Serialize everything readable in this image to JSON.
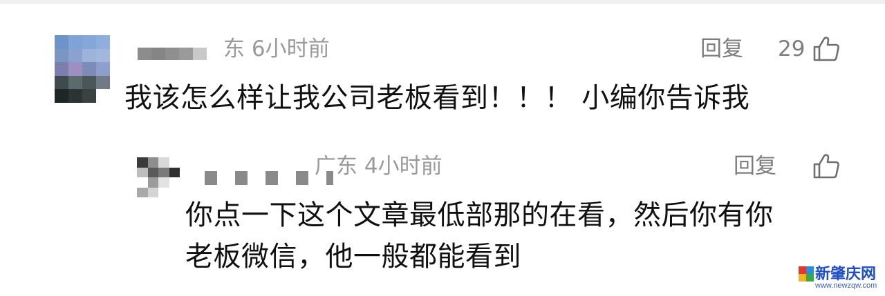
{
  "comment": {
    "location": "东",
    "time_ago": "6小时前",
    "reply_label": "回复",
    "like_count": "29",
    "text": "我该怎么样让我公司老板看到！！！ 小编你告诉我"
  },
  "reply": {
    "location": "广东",
    "time_ago": "4小时前",
    "reply_label": "回复",
    "text_line_1": "你点一下这个文章最低部那的在看，然后你有你",
    "text_line_2": "老板微信，他一般都能看到"
  },
  "watermark": {
    "title": "新肇庆网",
    "url": "www.newzqw.com"
  },
  "icons": {
    "like": "thumbs-up-icon"
  },
  "colors": {
    "meta_gray": "#9a9a9a",
    "action_gray": "#7d7d7d",
    "text": "#111111",
    "watermark_blue": "#1e4fc6"
  }
}
